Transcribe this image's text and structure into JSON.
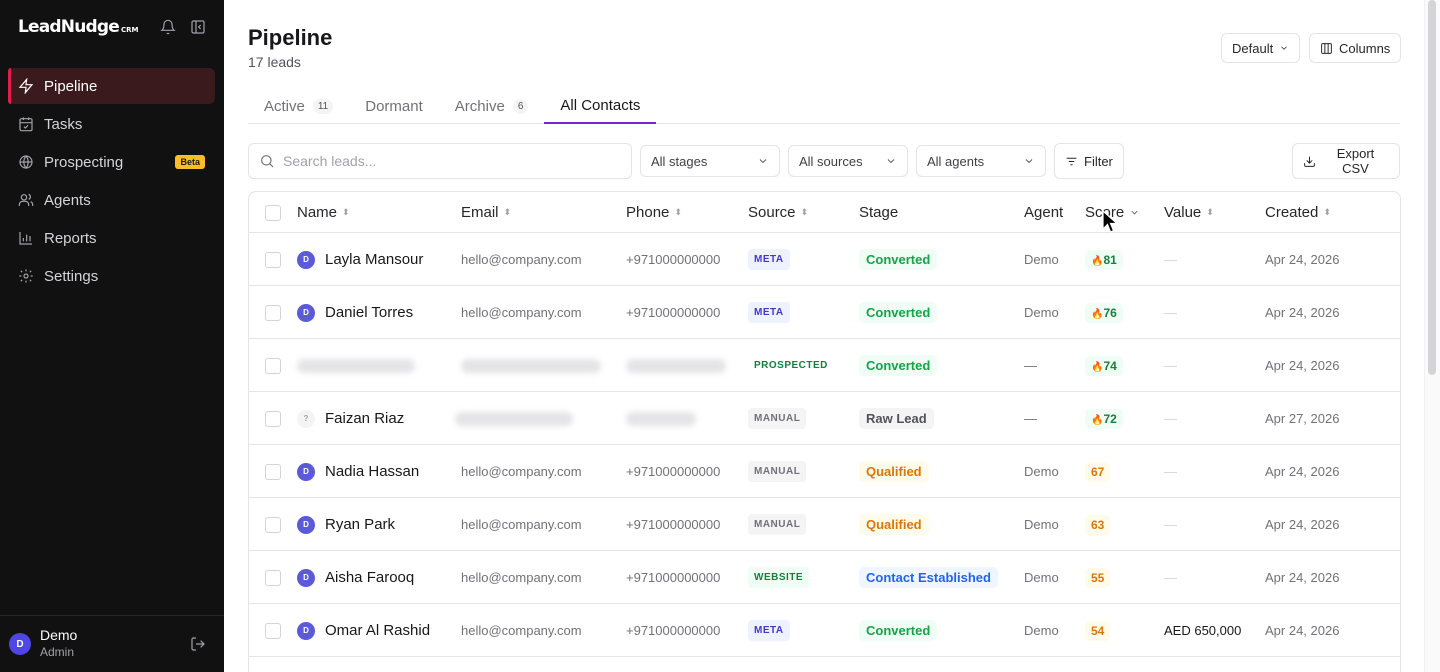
{
  "brand": {
    "logo_main": "LeadNudge",
    "logo_suffix": "CRM"
  },
  "sidebar": {
    "items": [
      {
        "label": "Pipeline",
        "icon": "lightning-icon",
        "active": true
      },
      {
        "label": "Tasks",
        "icon": "calendar-check-icon"
      },
      {
        "label": "Prospecting",
        "icon": "globe-icon",
        "badge": "Beta"
      },
      {
        "label": "Agents",
        "icon": "users-icon"
      },
      {
        "label": "Reports",
        "icon": "bar-chart-icon"
      },
      {
        "label": "Settings",
        "icon": "gear-icon"
      }
    ],
    "user": {
      "initial": "D",
      "name": "Demo",
      "role": "Admin"
    }
  },
  "header": {
    "title": "Pipeline",
    "subtitle": "17 leads",
    "view_label": "Default",
    "columns_label": "Columns"
  },
  "tabs": [
    {
      "label": "Active",
      "count": "11"
    },
    {
      "label": "Dormant",
      "count": ""
    },
    {
      "label": "Archive",
      "count": "6"
    },
    {
      "label": "All Contacts",
      "count": "",
      "active": true
    }
  ],
  "filters": {
    "search_placeholder": "Search leads...",
    "stages": "All stages",
    "sources": "All sources",
    "agents": "All agents",
    "filter_label": "Filter",
    "export_label": "Export CSV"
  },
  "table": {
    "columns": [
      "Name",
      "Email",
      "Phone",
      "Source",
      "Stage",
      "Agent",
      "Score",
      "Value",
      "Created"
    ],
    "rows": [
      {
        "initial": "D",
        "name": "Layla Mansour",
        "email": "hello@company.com",
        "phone": "+971000000000",
        "source": "META",
        "stage": "Converted",
        "agent": "Demo",
        "score": "81",
        "hot": true,
        "value": "—",
        "created": "Apr 24, 2026"
      },
      {
        "initial": "D",
        "name": "Daniel Torres",
        "email": "hello@company.com",
        "phone": "+971000000000",
        "source": "META",
        "stage": "Converted",
        "agent": "Demo",
        "score": "76",
        "hot": true,
        "value": "—",
        "created": "Apr 24, 2026"
      },
      {
        "initial": "",
        "name": "",
        "email": "",
        "phone": "",
        "source": "PROSPECTED",
        "stage": "Converted",
        "agent": "—",
        "score": "74",
        "hot": true,
        "value": "—",
        "created": "Apr 24, 2026",
        "blurred": true
      },
      {
        "initial": "?",
        "name": "Faizan Riaz",
        "email": "",
        "phone": "",
        "source": "MANUAL",
        "stage": "Raw Lead",
        "agent": "—",
        "score": "72",
        "hot": true,
        "value": "—",
        "created": "Apr 27, 2026",
        "blur_contact": true
      },
      {
        "initial": "D",
        "name": "Nadia Hassan",
        "email": "hello@company.com",
        "phone": "+971000000000",
        "source": "MANUAL",
        "stage": "Qualified",
        "agent": "Demo",
        "score": "67",
        "hot": false,
        "value": "—",
        "created": "Apr 24, 2026"
      },
      {
        "initial": "D",
        "name": "Ryan Park",
        "email": "hello@company.com",
        "phone": "+971000000000",
        "source": "MANUAL",
        "stage": "Qualified",
        "agent": "Demo",
        "score": "63",
        "hot": false,
        "value": "—",
        "created": "Apr 24, 2026"
      },
      {
        "initial": "D",
        "name": "Aisha Farooq",
        "email": "hello@company.com",
        "phone": "+971000000000",
        "source": "WEBSITE",
        "stage": "Contact Established",
        "agent": "Demo",
        "score": "55",
        "hot": false,
        "value": "—",
        "created": "Apr 24, 2026"
      },
      {
        "initial": "D",
        "name": "Omar Al Rashid",
        "email": "hello@company.com",
        "phone": "+971000000000",
        "source": "META",
        "stage": "Converted",
        "agent": "Demo",
        "score": "54",
        "hot": false,
        "value": "AED 650,000",
        "created": "Apr 24, 2026"
      }
    ]
  },
  "colors": {
    "source": {
      "META": {
        "bg": "#eef2ff",
        "fg": "#4338ca"
      },
      "PROSPECTED": {
        "bg": "#ffffff",
        "fg": "#15803d"
      },
      "MANUAL": {
        "bg": "#f4f4f5",
        "fg": "#71717a"
      },
      "WEBSITE": {
        "bg": "#f0fdf4",
        "fg": "#15803d"
      }
    },
    "stage": {
      "Converted": {
        "bg": "#f0fdf4",
        "fg": "#16a34a"
      },
      "Raw Lead": {
        "bg": "#f4f4f5",
        "fg": "#52525b"
      },
      "Qualified": {
        "bg": "#fffbeb",
        "fg": "#d97706"
      },
      "Contact Established": {
        "bg": "#eff6ff",
        "fg": "#2563eb"
      }
    },
    "score_hot": {
      "bg": "#f0fdf4",
      "fg": "#15803d"
    },
    "score_warm": {
      "bg": "#fffbeb",
      "fg": "#d97706"
    }
  }
}
